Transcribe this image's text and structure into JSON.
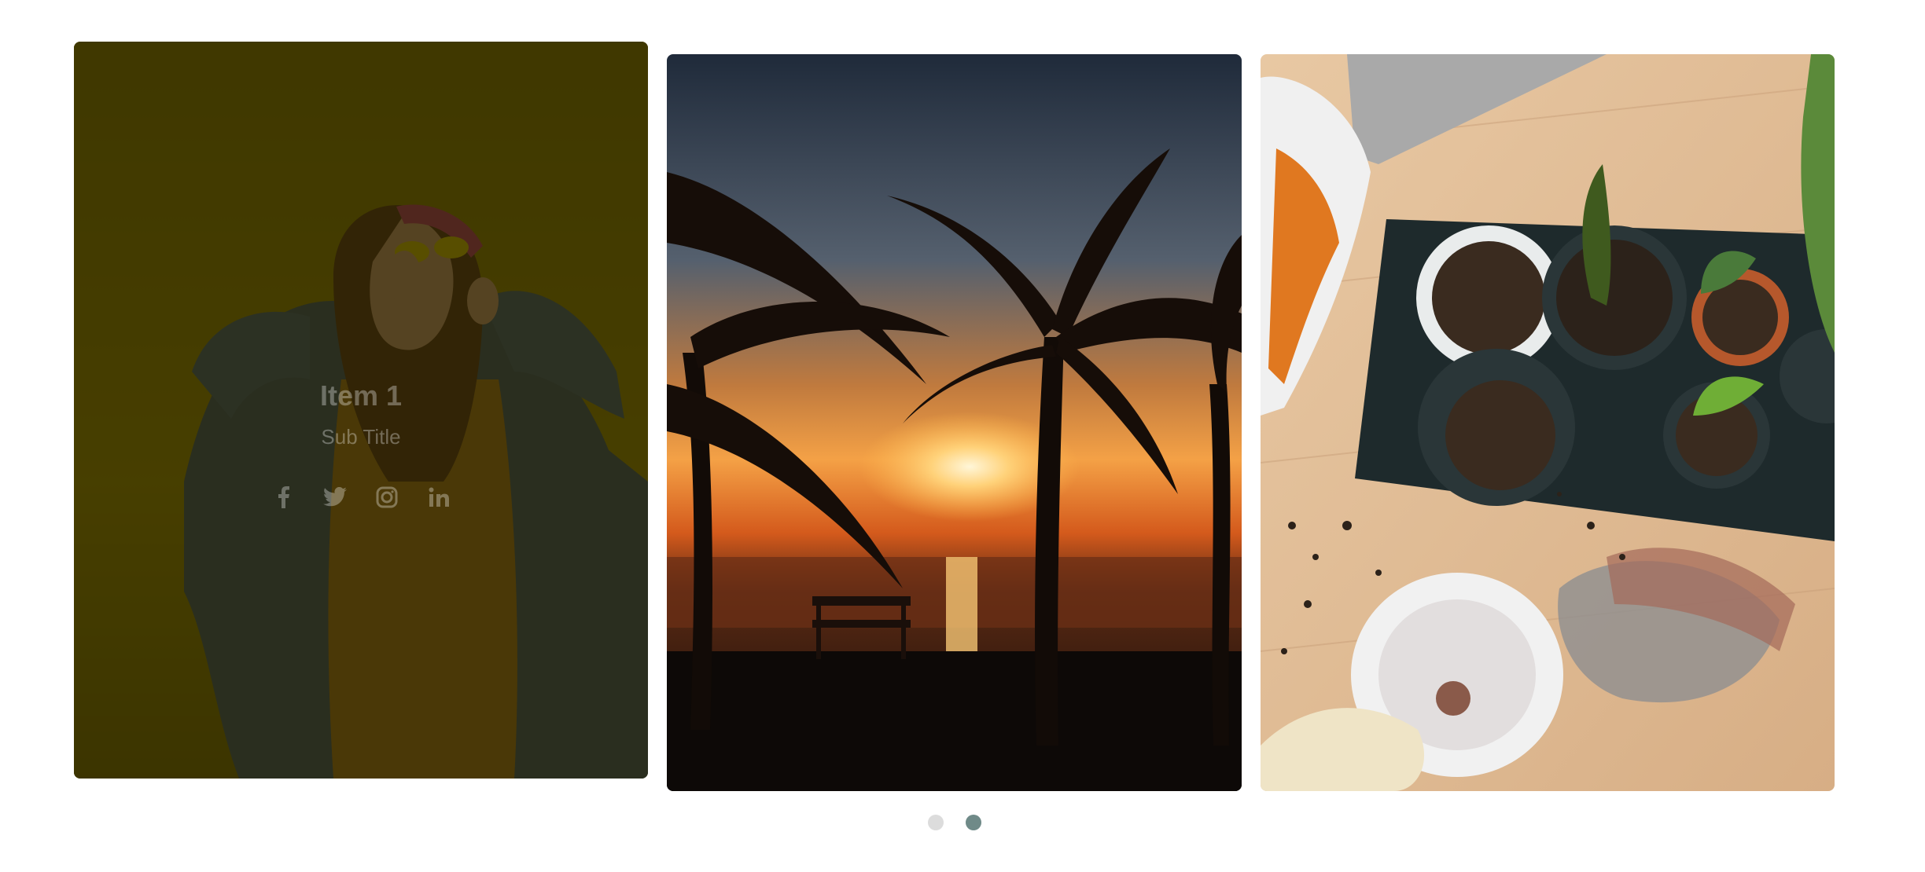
{
  "slides": [
    {
      "title": "Item 1",
      "subtitle": "Sub Title",
      "overlay_color": "#232000",
      "image": "woman-sunglasses-photo",
      "social": [
        "facebook-icon",
        "twitter-icon",
        "instagram-icon",
        "linkedin-icon"
      ]
    },
    {
      "image": "palm-trees-sunset-photo"
    },
    {
      "image": "potted-plants-soil-photo"
    }
  ],
  "pagination": {
    "count": 2,
    "active_index": 1,
    "active_color": "#6f8a88",
    "inactive_color": "#dcdcdc"
  }
}
